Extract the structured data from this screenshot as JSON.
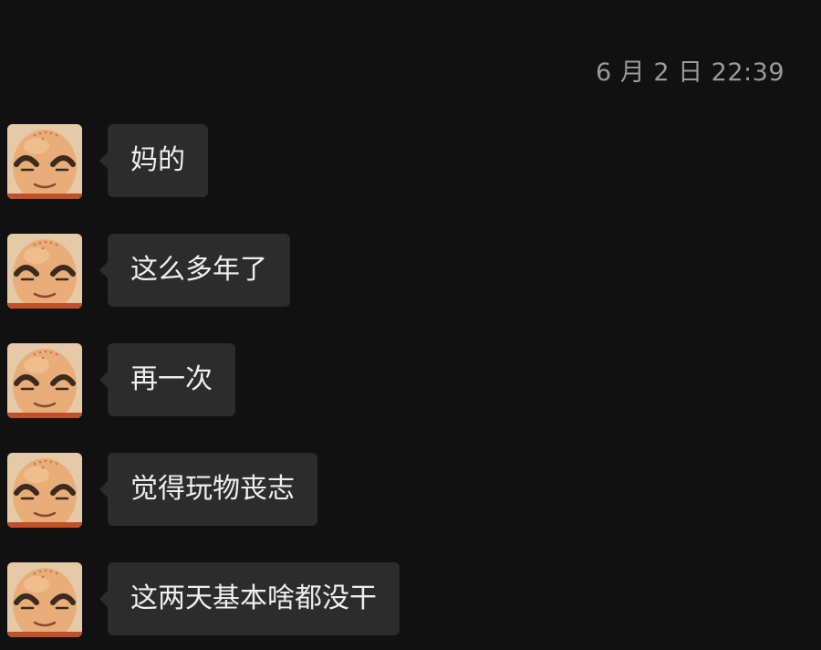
{
  "chat": {
    "timestamp": "6 月 2 日 22:39",
    "avatar_icon": "bald-monk-avatar-icon",
    "colors": {
      "background": "#111111",
      "bubble": "#2c2c2c",
      "text": "#efefef",
      "timestamp": "#9a9a9a"
    },
    "messages": [
      {
        "text": "妈的"
      },
      {
        "text": "这么多年了"
      },
      {
        "text": "再一次"
      },
      {
        "text": "觉得玩物丧志"
      },
      {
        "text": "这两天基本啥都没干"
      }
    ]
  }
}
